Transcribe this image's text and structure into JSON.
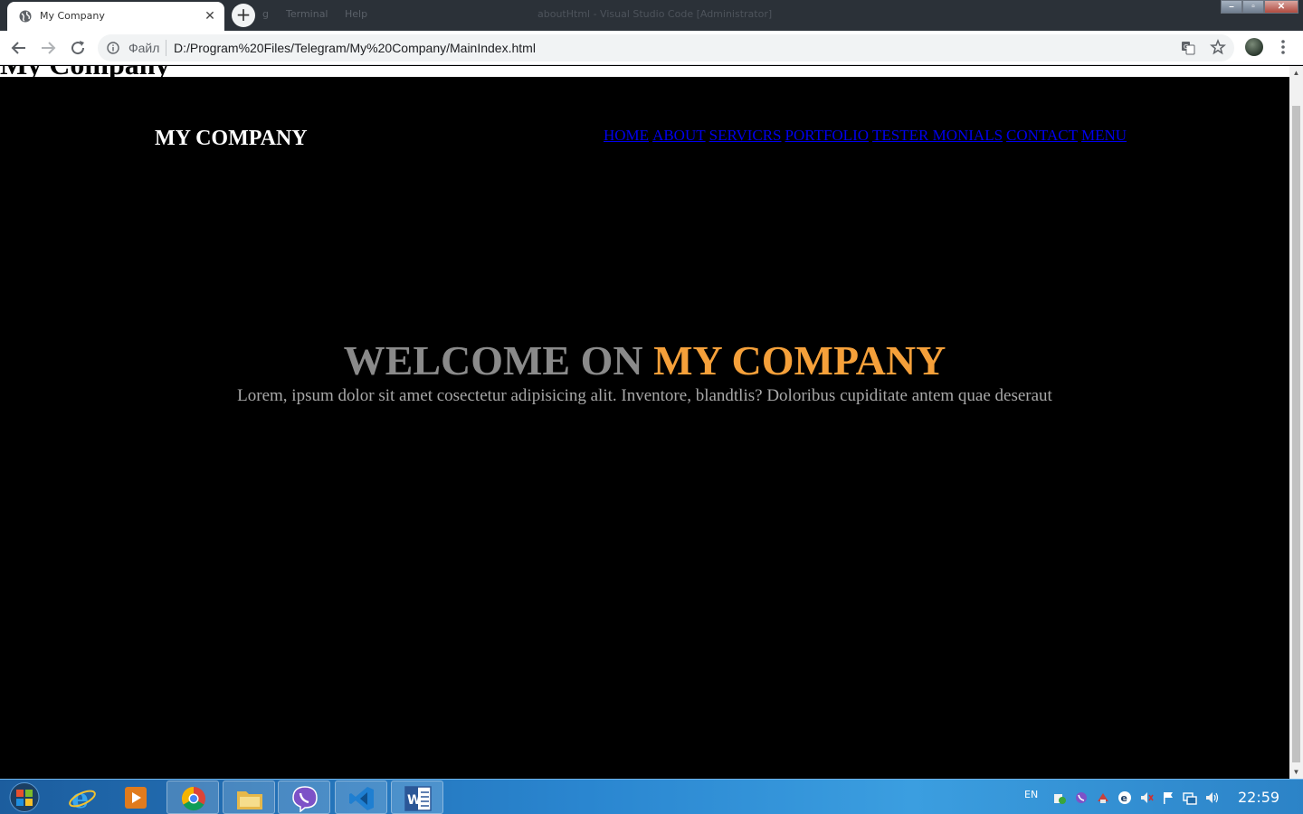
{
  "browser": {
    "background_window_menu": [
      "g",
      "Terminal",
      "Help"
    ],
    "background_window_title": "aboutHtml - Visual Studio Code [Administrator]",
    "tab": {
      "title": "My Company",
      "close_glyph": "✕"
    },
    "new_tab_glyph": "+",
    "address_bar": {
      "scheme_label": "Файл",
      "url": "D:/Program%20Files/Telegram/My%20Company/MainIndex.html"
    }
  },
  "page": {
    "doc_heading": "My Company",
    "brand": "MY COMPANY",
    "nav_links": [
      "HOME",
      "ABOUT",
      "SERVICRS",
      "PORTFOLIO",
      "TESTER MONIALS",
      "CONTACT",
      "MENU"
    ],
    "hero": {
      "title_part1": "WELCOME ON ",
      "title_part2": "MY COMPANY",
      "subtitle": "Lorem, ipsum dolor sit amet cosectetur adipisicing alit. Inventore, blandtlis? Doloribus cupiditate antem quae deseraut"
    },
    "colors": {
      "background": "#000000",
      "brand": "#ffffff",
      "nav_link": "#0000ee",
      "hero_muted": "#8a8a8a",
      "hero_accent": "#f5a03a",
      "subtitle": "#a8a8a8"
    }
  },
  "taskbar": {
    "apps": [
      "internet-explorer",
      "media-player",
      "chrome",
      "file-explorer",
      "viber",
      "vscode",
      "word"
    ],
    "language": "EN",
    "clock": "22:59"
  }
}
